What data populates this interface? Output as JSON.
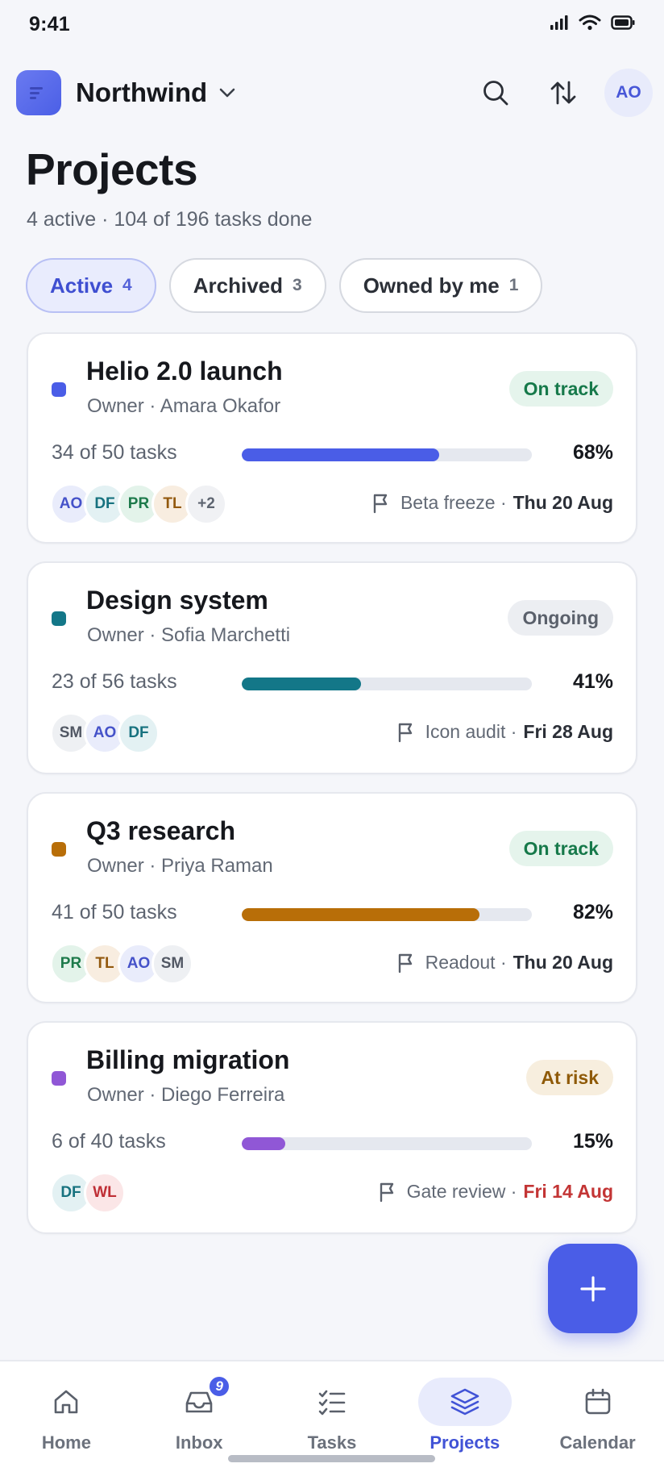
{
  "status_bar": {
    "time": "9:41"
  },
  "header": {
    "workspace": "Northwind",
    "avatar_initials": "AO"
  },
  "page": {
    "title": "Projects",
    "subtitle": "4 active · 104 of 196 tasks done"
  },
  "filters": [
    {
      "label": "Active",
      "count": "4",
      "active": true
    },
    {
      "label": "Archived",
      "count": "3",
      "active": false
    },
    {
      "label": "Owned by me",
      "count": "1",
      "active": false
    }
  ],
  "projects": [
    {
      "name": "Helio 2.0 launch",
      "owner": "Owner · Amara Okafor",
      "status": "On track",
      "color": "#4a5de7",
      "tasks": "34 of 50 tasks",
      "progress_pct": 68,
      "progress_label": "68%",
      "members": [
        "AO",
        "DF",
        "PR",
        "TL"
      ],
      "more_members": "+2",
      "milestone": "Beta freeze ·",
      "milestone_date": "Thu 20 Aug",
      "overdue": false
    },
    {
      "name": "Design system",
      "owner": "Owner · Sofia Marchetti",
      "status": "Ongoing",
      "color": "#137788",
      "tasks": "23 of 56 tasks",
      "progress_pct": 41,
      "progress_label": "41%",
      "members": [
        "SM",
        "AO",
        "DF"
      ],
      "more_members": "",
      "milestone": "Icon audit ·",
      "milestone_date": "Fri 28 Aug",
      "overdue": false
    },
    {
      "name": "Q3 research",
      "owner": "Owner · Priya Raman",
      "status": "On track",
      "color": "#b86e08",
      "tasks": "41 of 50 tasks",
      "progress_pct": 82,
      "progress_label": "82%",
      "members": [
        "PR",
        "TL",
        "AO",
        "SM"
      ],
      "more_members": "",
      "milestone": "Readout ·",
      "milestone_date": "Thu 20 Aug",
      "overdue": false
    },
    {
      "name": "Billing migration",
      "owner": "Owner · Diego Ferreira",
      "status": "At risk",
      "color": "#9057d6",
      "tasks": "6 of 40 tasks",
      "progress_pct": 15,
      "progress_label": "15%",
      "members": [
        "DF",
        "WL"
      ],
      "more_members": "",
      "milestone": "Gate review ·",
      "milestone_date": "Fri 14 Aug",
      "overdue": true
    }
  ],
  "tab_bar": {
    "home": "Home",
    "inbox": "Inbox",
    "inbox_badge": "9",
    "tasks": "Tasks",
    "projects": "Projects",
    "calendar": "Calendar"
  },
  "icons": {
    "search": "search-icon",
    "sort": "sort-icon",
    "flag": "flag-icon",
    "add": "plus-icon"
  },
  "colors": {
    "accent": "#4a5de7",
    "on_track": "#16794a",
    "at_risk": "#8f5a08",
    "overdue": "#c33535"
  }
}
